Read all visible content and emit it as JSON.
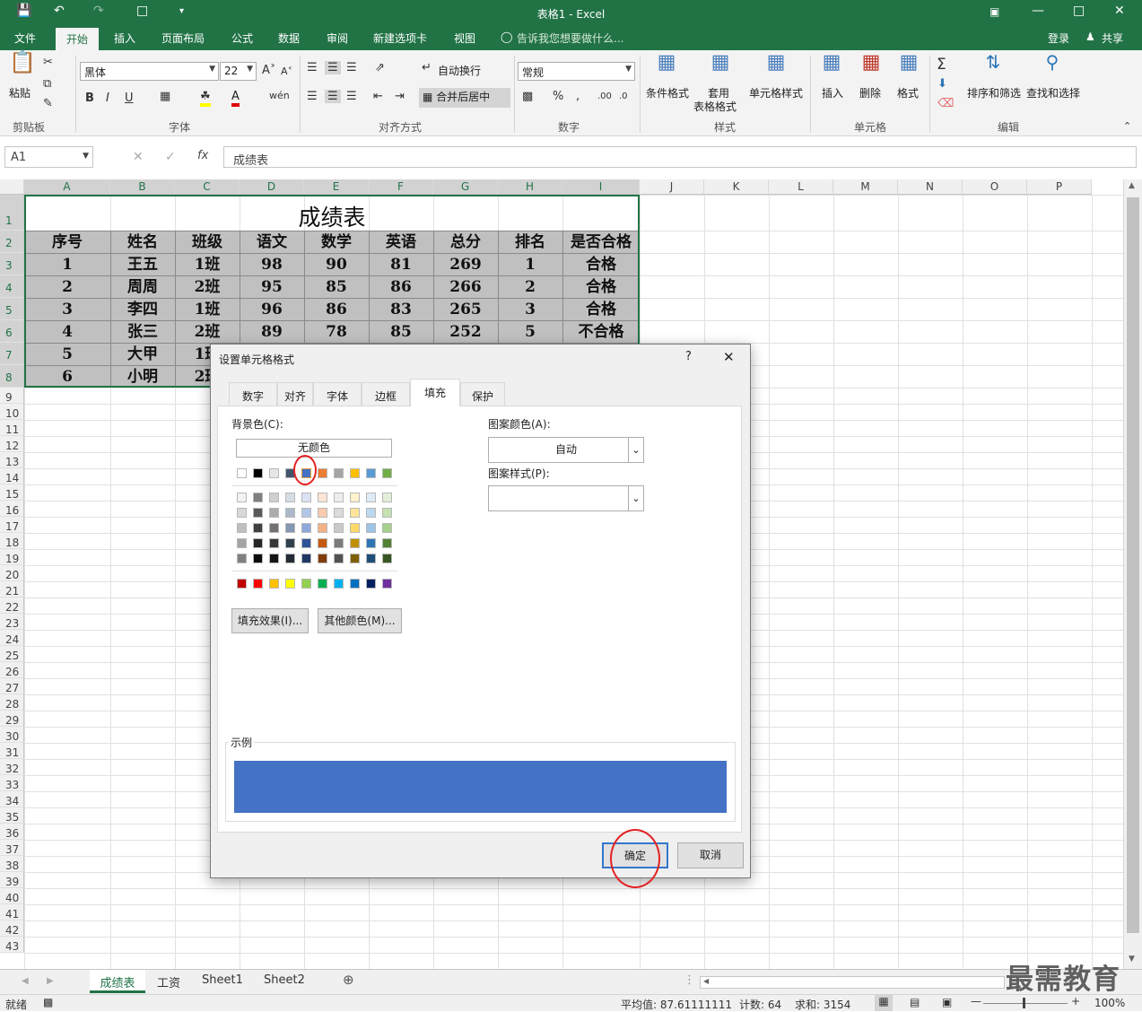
{
  "app": {
    "window_title": "表格1 - Excel",
    "login": "登录",
    "share": "共享"
  },
  "ribbon_tabs": [
    "文件",
    "开始",
    "插入",
    "页面布局",
    "公式",
    "数据",
    "审阅",
    "新建选项卡",
    "视图"
  ],
  "tell_me": "告诉我您想要做什么...",
  "ribbon": {
    "paste": "粘贴",
    "font_name": "黑体",
    "font_size": "22",
    "wrap_text": "自动换行",
    "merge_center": "合并后居中",
    "number_format": "常规",
    "cond_format": "条件格式",
    "table_format_1": "套用",
    "table_format_2": "表格格式",
    "cell_style": "单元格样式",
    "insert": "插入",
    "delete": "删除",
    "format": "格式",
    "sort_filter": "排序和筛选",
    "find_select": "查找和选择",
    "groups": [
      "剪贴板",
      "字体",
      "对齐方式",
      "数字",
      "样式",
      "单元格",
      "编辑"
    ]
  },
  "formula_bar": {
    "name_box": "A1",
    "content": "成绩表"
  },
  "columns": [
    "A",
    "B",
    "C",
    "D",
    "E",
    "F",
    "G",
    "H",
    "I",
    "J",
    "K",
    "L",
    "M",
    "N",
    "O",
    "P"
  ],
  "rows": [
    "1",
    "2",
    "3",
    "4",
    "5",
    "6",
    "7",
    "8",
    "9",
    "10",
    "11",
    "12",
    "13",
    "14",
    "15",
    "16",
    "17",
    "18",
    "19",
    "20",
    "21",
    "22",
    "23",
    "24",
    "25",
    "26",
    "27",
    "28",
    "29",
    "30",
    "31",
    "32",
    "33",
    "34",
    "35",
    "36",
    "37",
    "38",
    "39",
    "40",
    "41",
    "42",
    "43"
  ],
  "sheet": {
    "title": "成绩表",
    "headers": [
      "序号",
      "姓名",
      "班级",
      "语文",
      "数学",
      "英语",
      "总分",
      "排名",
      "是否合格"
    ],
    "data": [
      [
        "1",
        "王五",
        "1班",
        "98",
        "90",
        "81",
        "269",
        "1",
        "合格"
      ],
      [
        "2",
        "周周",
        "2班",
        "95",
        "85",
        "86",
        "266",
        "2",
        "合格"
      ],
      [
        "3",
        "李四",
        "1班",
        "96",
        "86",
        "83",
        "265",
        "3",
        "合格"
      ],
      [
        "4",
        "张三",
        "2班",
        "89",
        "78",
        "85",
        "252",
        "5",
        "不合格"
      ],
      [
        "5",
        "大甲",
        "1班",
        "",
        "",
        "",
        "",
        "",
        ""
      ],
      [
        "6",
        "小明",
        "2班",
        "",
        "",
        "",
        "",
        "",
        ""
      ]
    ],
    "row7_partial": "1班",
    "row8_partial": "2班"
  },
  "sheet_tabs": [
    "成绩表",
    "工资",
    "Sheet1",
    "Sheet2"
  ],
  "status": {
    "ready": "就绪",
    "average": "平均值: 87.61111111",
    "count": "计数: 64",
    "sum": "求和: 3154",
    "zoom": "100%"
  },
  "watermark": "最需教育",
  "dialog": {
    "title": "设置单元格格式",
    "help": "?",
    "tabs": [
      "数字",
      "对齐",
      "字体",
      "边框",
      "填充",
      "保护"
    ],
    "active_tab": "填充",
    "bg_color_label": "背景色(C):",
    "no_color": "无颜色",
    "pattern_color_label": "图案颜色(A):",
    "pattern_color_value": "自动",
    "pattern_style_label": "图案样式(P):",
    "fill_effects": "填充效果(I)...",
    "more_colors": "其他颜色(M)...",
    "sample_label": "示例",
    "sample_color": "#4472c4",
    "ok": "确定",
    "cancel": "取消",
    "theme_colors": [
      "#ffffff",
      "#000000",
      "#e7e6e6",
      "#44546a",
      "#4472c4",
      "#ed7d31",
      "#a5a5a5",
      "#ffc000",
      "#5b9bd5",
      "#70ad47"
    ],
    "shades": [
      [
        "#f2f2f2",
        "#7f7f7f",
        "#d0cece",
        "#d6dce4",
        "#d9e2f3",
        "#fbe5d5",
        "#ededed",
        "#fff2cc",
        "#deebf6",
        "#e2efd9"
      ],
      [
        "#d8d8d8",
        "#595959",
        "#aeabab",
        "#adb9ca",
        "#b4c6e7",
        "#f7cbac",
        "#dbdbdb",
        "#fee599",
        "#bdd7ee",
        "#c5e0b3"
      ],
      [
        "#bfbfbf",
        "#3f3f3f",
        "#757070",
        "#8496b0",
        "#8eaadb",
        "#f4b183",
        "#c9c9c9",
        "#ffd966",
        "#9dc3e6",
        "#a8d08d"
      ],
      [
        "#a5a5a5",
        "#262626",
        "#3a3838",
        "#323f4f",
        "#2f5496",
        "#c55a11",
        "#7b7b7b",
        "#bf9000",
        "#2e75b5",
        "#538135"
      ],
      [
        "#7f7f7f",
        "#0c0c0c",
        "#171616",
        "#222a35",
        "#1f3864",
        "#833c0b",
        "#525252",
        "#7f6000",
        "#1f4e79",
        "#375623"
      ]
    ],
    "standard_colors": [
      "#c00000",
      "#ff0000",
      "#ffc000",
      "#ffff00",
      "#92d050",
      "#00b050",
      "#00b0f0",
      "#0070c0",
      "#002060",
      "#7030a0"
    ]
  }
}
